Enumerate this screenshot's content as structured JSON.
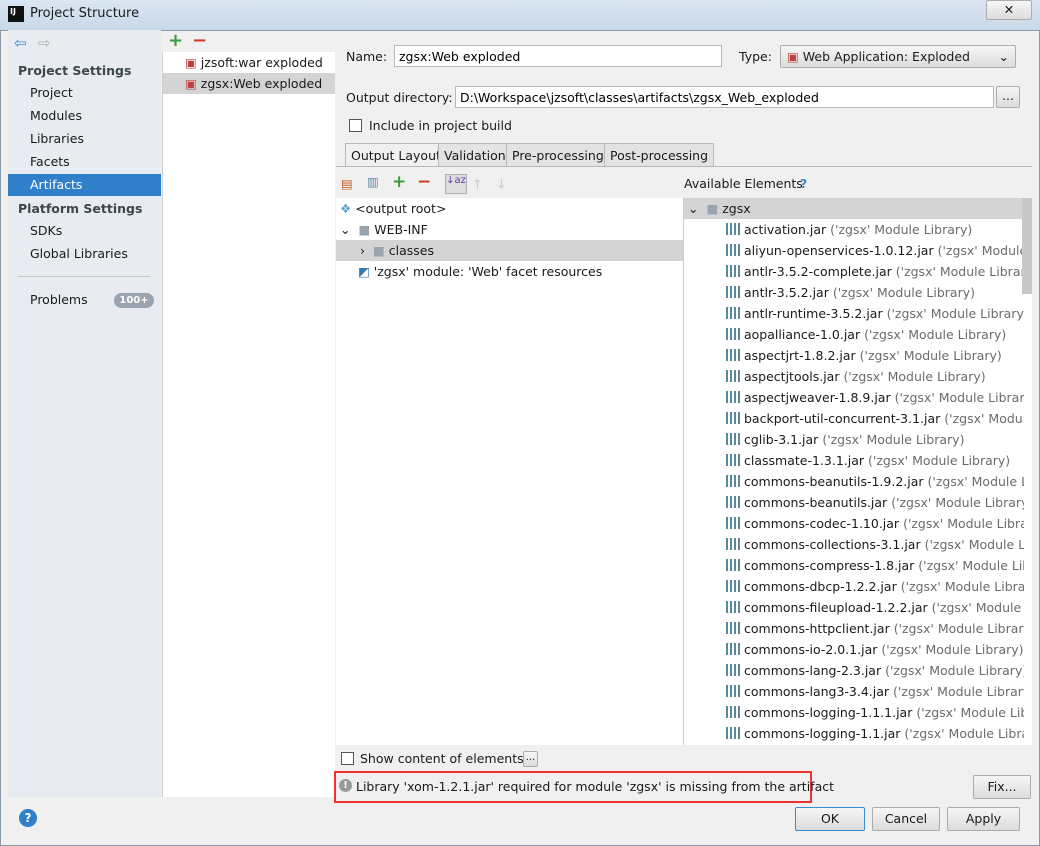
{
  "window": {
    "title": "Project Structure",
    "app_icon": "IJ"
  },
  "sidebar": {
    "project_settings": "Project Settings",
    "items": [
      {
        "label": "Project"
      },
      {
        "label": "Modules"
      },
      {
        "label": "Libraries"
      },
      {
        "label": "Facets"
      },
      {
        "label": "Artifacts",
        "selected": true
      }
    ],
    "platform_settings": "Platform Settings",
    "platform_items": [
      {
        "label": "SDKs"
      },
      {
        "label": "Global Libraries"
      }
    ],
    "problems": {
      "label": "Problems",
      "badge": "100+"
    }
  },
  "artifacts": [
    {
      "label": "jzsoft:war exploded"
    },
    {
      "label": "zgsx:Web exploded",
      "selected": true
    }
  ],
  "form": {
    "name_label": "Name:",
    "name_value": "zgsx:Web exploded",
    "type_label": "Type:",
    "type_value": "Web Application: Exploded",
    "output_label": "Output directory:",
    "output_value": "D:\\Workspace\\jzsoft\\classes\\artifacts\\zgsx_Web_exploded",
    "browse": "...",
    "include_label": "Include in project build",
    "include_checked": false
  },
  "tabs": [
    {
      "label": "Output Layout",
      "active": true
    },
    {
      "label": "Validation"
    },
    {
      "label": "Pre-processing"
    },
    {
      "label": "Post-processing"
    }
  ],
  "layout_tree": [
    {
      "label": "<output root>",
      "icon": "output-root-icon"
    },
    {
      "label": "WEB-INF",
      "icon": "folder-icon",
      "expanded": true
    },
    {
      "label": "classes",
      "icon": "folder-icon",
      "expanded": false,
      "selected": true
    },
    {
      "label": "'zgsx' module: 'Web' facet resources",
      "icon": "module-icon"
    }
  ],
  "available": {
    "title": "Available Elements",
    "help": "?",
    "root": "zgsx",
    "items": [
      {
        "name": "activation.jar",
        "suffix": "('zgsx' Module Library)"
      },
      {
        "name": "aliyun-openservices-1.0.12.jar",
        "suffix": "('zgsx' Module Library)"
      },
      {
        "name": "antlr-3.5.2-complete.jar",
        "suffix": "('zgsx' Module Library)"
      },
      {
        "name": "antlr-3.5.2.jar",
        "suffix": "('zgsx' Module Library)"
      },
      {
        "name": "antlr-runtime-3.5.2.jar",
        "suffix": "('zgsx' Module Library)"
      },
      {
        "name": "aopalliance-1.0.jar",
        "suffix": "('zgsx' Module Library)"
      },
      {
        "name": "aspectjrt-1.8.2.jar",
        "suffix": "('zgsx' Module Library)"
      },
      {
        "name": "aspectjtools.jar",
        "suffix": "('zgsx' Module Library)"
      },
      {
        "name": "aspectjweaver-1.8.9.jar",
        "suffix": "('zgsx' Module Library)"
      },
      {
        "name": "backport-util-concurrent-3.1.jar",
        "suffix": "('zgsx' Module Library)"
      },
      {
        "name": "cglib-3.1.jar",
        "suffix": "('zgsx' Module Library)"
      },
      {
        "name": "classmate-1.3.1.jar",
        "suffix": "('zgsx' Module Library)"
      },
      {
        "name": "commons-beanutils-1.9.2.jar",
        "suffix": "('zgsx' Module Library)"
      },
      {
        "name": "commons-beanutils.jar",
        "suffix": "('zgsx' Module Library)"
      },
      {
        "name": "commons-codec-1.10.jar",
        "suffix": "('zgsx' Module Library)"
      },
      {
        "name": "commons-collections-3.1.jar",
        "suffix": "('zgsx' Module Library)"
      },
      {
        "name": "commons-compress-1.8.jar",
        "suffix": "('zgsx' Module Library)"
      },
      {
        "name": "commons-dbcp-1.2.2.jar",
        "suffix": "('zgsx' Module Library)"
      },
      {
        "name": "commons-fileupload-1.2.2.jar",
        "suffix": "('zgsx' Module Library)"
      },
      {
        "name": "commons-httpclient.jar",
        "suffix": "('zgsx' Module Library)"
      },
      {
        "name": "commons-io-2.0.1.jar",
        "suffix": "('zgsx' Module Library)"
      },
      {
        "name": "commons-lang-2.3.jar",
        "suffix": "('zgsx' Module Library)"
      },
      {
        "name": "commons-lang3-3.4.jar",
        "suffix": "('zgsx' Module Library)"
      },
      {
        "name": "commons-logging-1.1.1.jar",
        "suffix": "('zgsx' Module Library)"
      },
      {
        "name": "commons-logging-1.1.jar",
        "suffix": "('zgsx' Module Library)"
      }
    ]
  },
  "bottom": {
    "show_content": "Show content of elements",
    "show_content_btn": "...",
    "warning": "Library 'xom-1.2.1.jar' required for module 'zgsx' is missing from the artifact",
    "fix": "Fix...",
    "ok": "OK",
    "cancel": "Cancel",
    "apply": "Apply",
    "help": "?"
  },
  "colors": {
    "selection": "#2f7fcb",
    "highlight_box": "#ee3333",
    "add": "#3a9a3a",
    "remove": "#d03a2a"
  }
}
